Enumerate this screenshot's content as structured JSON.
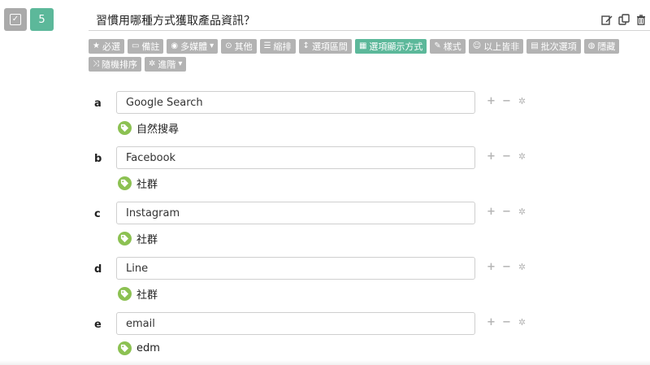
{
  "question": {
    "number": "5",
    "title": "習慣用哪種方式獲取產品資訊？",
    "type_icon": "checkbox-icon"
  },
  "header_tools": [
    "edit-icon",
    "copy-icon",
    "trash-icon"
  ],
  "toolbar": {
    "buttons": [
      {
        "label": "必選",
        "icon": "star-icon"
      },
      {
        "label": "備註",
        "icon": "comment-icon"
      },
      {
        "label": "多媒體",
        "icon": "camera-icon",
        "dropdown": true
      },
      {
        "label": "其他",
        "icon": "radio-icon"
      },
      {
        "label": "縮排",
        "icon": "indent-icon"
      },
      {
        "label": "選項區間",
        "icon": "arrows-vertical-icon"
      },
      {
        "label": "選項顯示方式",
        "icon": "grid-icon",
        "active": true
      },
      {
        "label": "樣式",
        "icon": "brush-icon"
      },
      {
        "label": "以上皆非",
        "icon": "smile-icon"
      },
      {
        "label": "批次選項",
        "icon": "file-icon"
      },
      {
        "label": "隱藏",
        "icon": "eye-slash-icon"
      },
      {
        "label": "隨機排序",
        "icon": "shuffle-icon"
      },
      {
        "label": "進階",
        "icon": "gear-icon",
        "dropdown": true
      }
    ]
  },
  "options": [
    {
      "letter": "a",
      "value": "Google Search",
      "tag": "自然搜尋"
    },
    {
      "letter": "b",
      "value": "Facebook",
      "tag": "社群"
    },
    {
      "letter": "c",
      "value": "Instagram",
      "tag": "社群"
    },
    {
      "letter": "d",
      "value": "Line",
      "tag": "社群"
    },
    {
      "letter": "e",
      "value": "email",
      "tag": "edm"
    }
  ],
  "colors": {
    "accent": "#5cb89a",
    "button_gray": "#b3b3b3",
    "tag_green": "#8cc152"
  }
}
